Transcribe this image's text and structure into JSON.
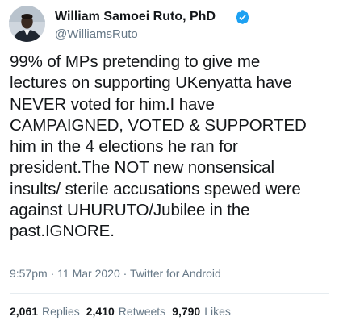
{
  "author": {
    "name": "William Samoei Ruto, PhD",
    "handle": "@WilliamsRuto",
    "verified": true,
    "avatar_icon": "profile-photo"
  },
  "tweet": {
    "text": "99% of MPs pretending to give me\nlectures on supporting UKenyatta have\nNEVER voted for him.I have\nCAMPAIGNED, VOTED & SUPPORTED\nhim in the 4 elections he ran for\npresident.The NOT new nonsensical\ninsults/ sterile accusations spewed were\nagainst UHURUTO/Jubilee in the\npast.IGNORE."
  },
  "meta": {
    "time": "9:57pm",
    "separator": " · ",
    "date": "11 Mar 2020",
    "source": "Twitter for Android"
  },
  "stats": {
    "replies_count": "2,061",
    "replies_label": "Replies",
    "retweets_count": "2,410",
    "retweets_label": "Retweets",
    "likes_count": "9,790",
    "likes_label": "Likes"
  },
  "colors": {
    "text": "#14171a",
    "secondary": "#657786",
    "verified": "#1da1f2",
    "divider": "#e6ecf0"
  }
}
